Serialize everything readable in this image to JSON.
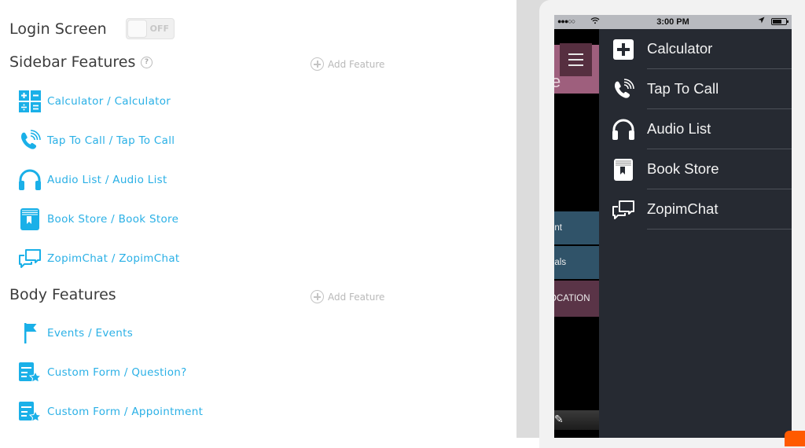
{
  "login": {
    "label": "Login Screen",
    "toggle_state": "OFF"
  },
  "sidebar_section": {
    "title": "Sidebar Features",
    "help_icon": "question-circle-icon",
    "add_label": "Add Feature",
    "items": [
      {
        "icon": "calculator-icon",
        "label": "Calculator / Calculator"
      },
      {
        "icon": "phone-call-icon",
        "label": "Tap To Call / Tap To Call"
      },
      {
        "icon": "headphones-icon",
        "label": "Audio List / Audio List"
      },
      {
        "icon": "book-icon",
        "label": "Book Store / Book Store"
      },
      {
        "icon": "chat-bubbles-icon",
        "label": "ZopimChat / ZopimChat"
      }
    ]
  },
  "body_section": {
    "title": "Body Features",
    "add_label": "Add Feature",
    "items": [
      {
        "icon": "flag-icon",
        "label": "Events / Events"
      },
      {
        "icon": "form-star-icon",
        "label": "Custom Form / Question?"
      },
      {
        "icon": "form-star-icon",
        "label": "Custom Form / Appointment"
      }
    ]
  },
  "preview": {
    "status": {
      "signal": "●●●○○",
      "wifi": "wifi-icon",
      "time": "3:00 PM",
      "location": "location-arrow-icon",
      "battery": "battery-icon"
    },
    "behind": {
      "letter": "e",
      "tiles": [
        "ent",
        "nals",
        "OCATION"
      ],
      "tab_label": "Page"
    },
    "drawer": [
      {
        "icon": "plus-square-icon",
        "label": "Calculator"
      },
      {
        "icon": "phone-call-icon",
        "label": "Tap To Call"
      },
      {
        "icon": "headphones-icon",
        "label": "Audio List"
      },
      {
        "icon": "book-icon",
        "label": "Book Store"
      },
      {
        "icon": "chat-bubbles-icon",
        "label": "ZopimChat"
      }
    ]
  },
  "colors": {
    "accent": "#2ab0e6",
    "drawer_bg": "#262a32",
    "pink": "#9e5f7d",
    "orange": "#ff5a00"
  }
}
